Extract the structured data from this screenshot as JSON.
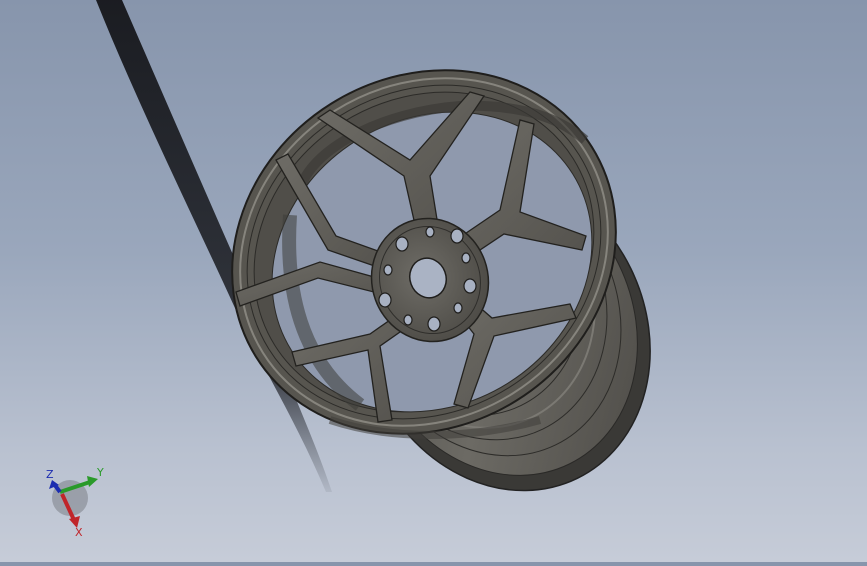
{
  "viewport": {
    "model": "wheel-rim",
    "colors": {
      "background_top": "#8795ac",
      "background_bottom": "#c6ccd8",
      "wheel_body": "#5f5d58",
      "wheel_edge": "#2b2a28",
      "shadow": "#15161a"
    }
  },
  "triad": {
    "x_label": "X",
    "y_label": "Y",
    "z_label": "Z",
    "x_color": "#c0252a",
    "y_color": "#2a9a2a",
    "z_color": "#1c2db0"
  }
}
